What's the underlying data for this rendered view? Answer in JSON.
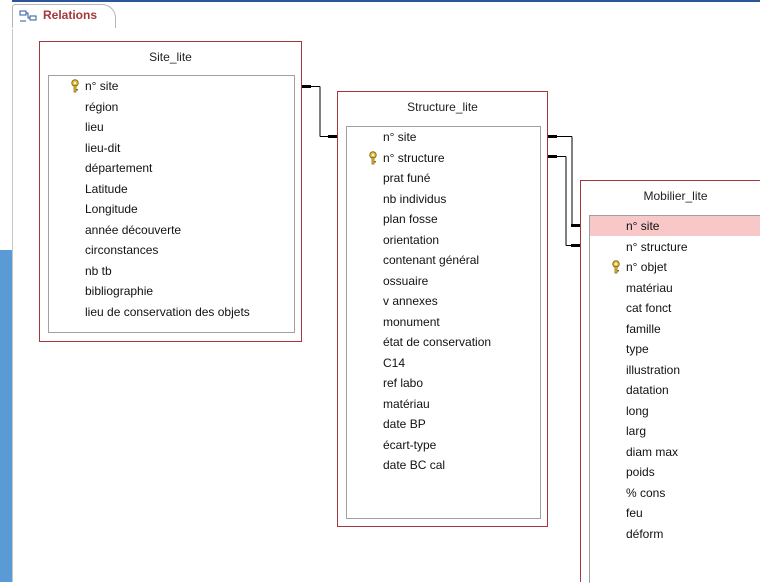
{
  "tab": {
    "label": "Relations",
    "icon": "relationships-icon"
  },
  "colors": {
    "accent": "#a4373a",
    "selected_row": "#f8c8c8",
    "window_blue": "#5b9bd5"
  },
  "tables": [
    {
      "id": "site",
      "title": "Site_lite",
      "fields": [
        {
          "label": "n° site",
          "key": true
        },
        {
          "label": "région"
        },
        {
          "label": "lieu"
        },
        {
          "label": "lieu-dit"
        },
        {
          "label": "département"
        },
        {
          "label": "Latitude"
        },
        {
          "label": "Longitude"
        },
        {
          "label": "année découverte"
        },
        {
          "label": "circonstances"
        },
        {
          "label": "nb tb"
        },
        {
          "label": "bibliographie"
        },
        {
          "label": "lieu de conservation des objets"
        }
      ]
    },
    {
      "id": "structure",
      "title": "Structure_lite",
      "fields": [
        {
          "label": "n° site"
        },
        {
          "label": "n° structure",
          "key": true
        },
        {
          "label": "prat funé"
        },
        {
          "label": "nb individus"
        },
        {
          "label": "plan fosse"
        },
        {
          "label": "orientation"
        },
        {
          "label": "contenant général"
        },
        {
          "label": "ossuaire"
        },
        {
          "label": "v annexes"
        },
        {
          "label": "monument"
        },
        {
          "label": "état de conservation"
        },
        {
          "label": "C14"
        },
        {
          "label": "ref labo"
        },
        {
          "label": "matériau"
        },
        {
          "label": "date BP"
        },
        {
          "label": "écart-type"
        },
        {
          "label": "date BC cal"
        }
      ]
    },
    {
      "id": "mobilier",
      "title": "Mobilier_lite",
      "fields": [
        {
          "label": "n° site",
          "selected": true
        },
        {
          "label": "n° structure"
        },
        {
          "label": "n° objet",
          "key": true
        },
        {
          "label": "matériau"
        },
        {
          "label": "cat fonct"
        },
        {
          "label": "famille"
        },
        {
          "label": "type"
        },
        {
          "label": "illustration"
        },
        {
          "label": "datation"
        },
        {
          "label": "long"
        },
        {
          "label": "larg"
        },
        {
          "label": "diam max"
        },
        {
          "label": "poids"
        },
        {
          "label": "% cons"
        },
        {
          "label": "feu"
        },
        {
          "label": "déform"
        }
      ]
    }
  ]
}
